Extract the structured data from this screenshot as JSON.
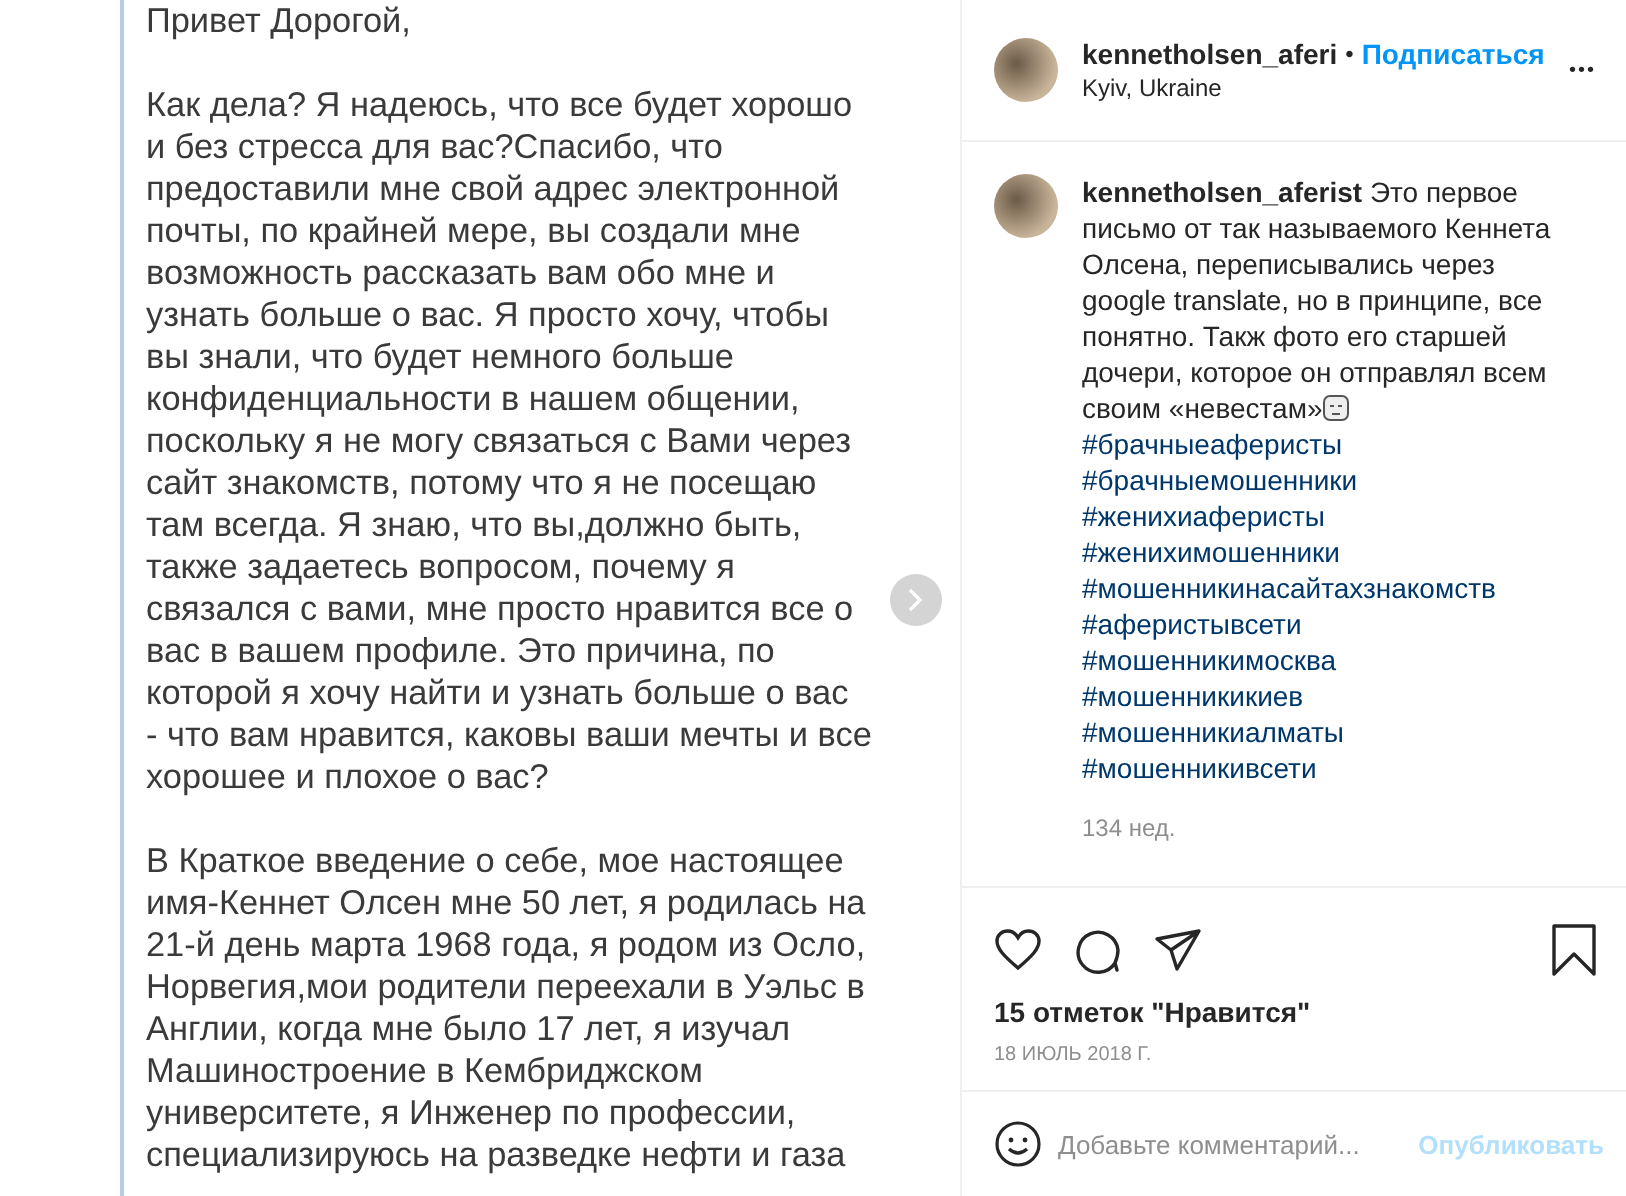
{
  "photo": {
    "paragraphs": [
      {
        "lines": [
          "Привет Дорогой,"
        ]
      },
      {
        "lines": [
          "Как дела? Я надеюсь, что все будет хорошо",
          "и без стресса для вас?Спасибо, что",
          "предоставили мне свой адрес электронной",
          "почты, по крайней мере, вы создали мне",
          "возможность рассказать вам обо мне и",
          "узнать больше о вас. Я просто хочу, чтобы",
          "вы знали, что будет немного больше",
          "конфиденциальности в нашем общении,",
          "поскольку я не могу связаться с Вами через",
          "сайт знакомств, потому что я не посещаю",
          "там всегда. Я знаю, что вы,должно быть,",
          "также задаетесь вопросом, почему я",
          "связался с вами, мне просто нравится все о",
          "вас в вашем профиле. Это причина, по",
          "которой я хочу найти и узнать больше о вас",
          "- что вам нравится, каковы ваши мечты и все",
          "хорошее и плохое о вас?"
        ]
      },
      {
        "lines": [
          "В Краткое введение о себе, мое настоящее",
          "имя-Кеннет Олсен мне 50 лет, я родилась на",
          "21-й день марта 1968 года, я родом из Осло,",
          "Норвегия,мои родители переехали в Уэльс в",
          "Англии, когда мне было 17 лет, я изучал",
          "Машиностроение в Кембриджском",
          "университете, я Инженер по профессии,",
          "специализируюсь на разведке нефти и газа"
        ]
      }
    ]
  },
  "header": {
    "username": "kennetholsen_aferi",
    "separator": "•",
    "follow": "Подписаться",
    "location": "Kyiv, Ukraine",
    "more": "•••"
  },
  "caption": {
    "username": "kennetholsen_aferist",
    "text": "Это первое письмо от так называемого Кеннета Олсена, переписывались через google translate, но в принципе, все понятно. Такж фото его старшей дочери, которое он отправлял всем своим «невестам»",
    "hashtags": [
      "#брачныеаферисты",
      "#брачныемошенники",
      "#женихиаферисты",
      "#женихимошенники",
      "#мошенникинасайтахзнакомств",
      "#аферистывсети",
      "#мошенникимосква",
      "#мошенникикиев",
      "#мошенникиалматы",
      "#мошенникивсети"
    ],
    "age": "134 нед."
  },
  "actions": {
    "liked": false,
    "saved": false
  },
  "likes": "15 отметок \"Нравится\"",
  "date": "18 ИЮЛЬ 2018 Г.",
  "comment": {
    "placeholder": "Добавьте комментарий...",
    "post": "Опубликовать"
  }
}
